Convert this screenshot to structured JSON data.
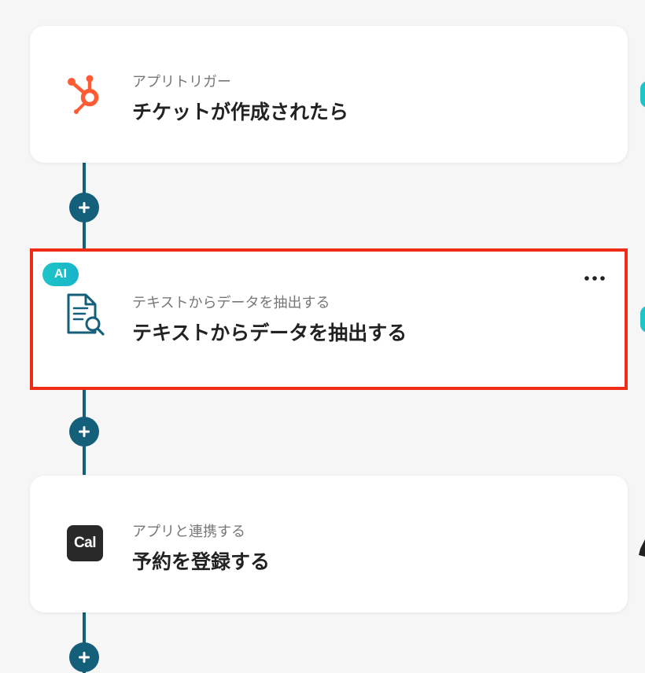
{
  "colors": {
    "accent": "#145f7a",
    "selection_border": "#ef2d16",
    "ai_badge": "#1ec5c8",
    "hubspot": "#ff5c35",
    "document_icon": "#145f7a",
    "cal_logo_bg": "#292929"
  },
  "flow": {
    "steps": [
      {
        "app_icon": "hubspot-icon",
        "subtitle": "アプリトリガー",
        "title": "チケットが作成されたら"
      },
      {
        "badge": "AI",
        "app_icon": "document-search-icon",
        "subtitle": "テキストからデータを抽出する",
        "title": "テキストからデータを抽出する",
        "menu_icon": "more-horizontal-icon",
        "selected": true
      },
      {
        "app_icon": "cal-com-icon",
        "logo_text": "Cal",
        "subtitle": "アプリと連携する",
        "title": "予約を登録する"
      }
    ],
    "add_step_icon": "plus-icon"
  }
}
